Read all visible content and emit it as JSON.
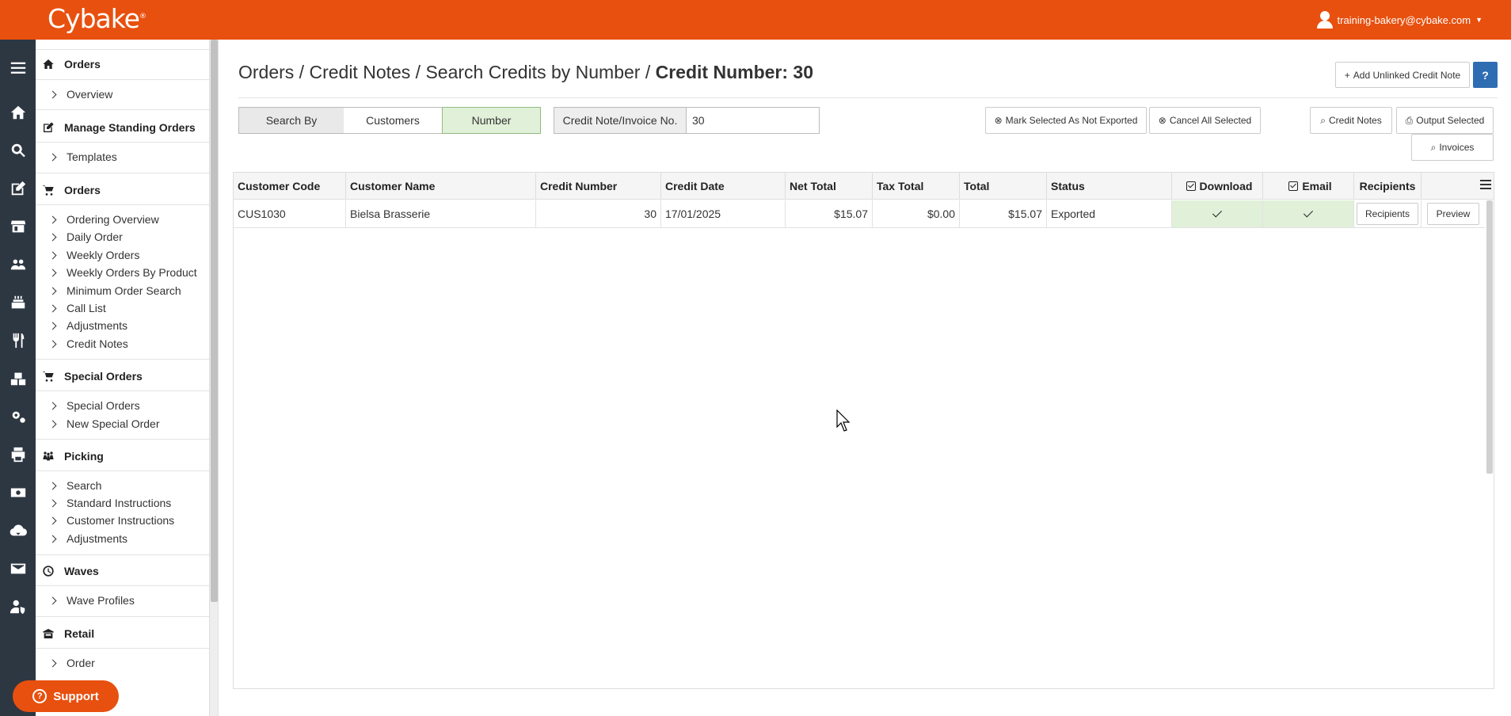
{
  "app": {
    "logo": "Cybake",
    "logo_mark": "®",
    "user_email": "training-bakery@cybake.com"
  },
  "sidebar": {
    "sections": [
      {
        "title": "Orders",
        "icon": "home-icon",
        "items": [
          "Overview"
        ]
      },
      {
        "title": "Manage Standing Orders",
        "icon": "edit-icon",
        "items": [
          "Templates"
        ]
      },
      {
        "title": "Orders",
        "icon": "cart-icon",
        "items": [
          "Ordering Overview",
          "Daily Order",
          "Weekly Orders",
          "Weekly Orders By Product",
          "Minimum Order Search",
          "Call List",
          "Adjustments",
          "Credit Notes"
        ]
      },
      {
        "title": "Special Orders",
        "icon": "cart-icon",
        "items": [
          "Special Orders",
          "New Special Order"
        ]
      },
      {
        "title": "Picking",
        "icon": "people-icon",
        "items": [
          "Search",
          "Standard Instructions",
          "Customer Instructions",
          "Adjustments"
        ]
      },
      {
        "title": "Waves",
        "icon": "clock-icon",
        "items": [
          "Wave Profiles"
        ]
      },
      {
        "title": "Retail",
        "icon": "retail-icon",
        "items": [
          "Order"
        ]
      }
    ],
    "support_label": "Support"
  },
  "page": {
    "breadcrumb": "Orders / Credit Notes / Search Credits by Number / ",
    "breadcrumb_current": "Credit Number: 30",
    "add_unlinked": "Add Unlinked Credit Note",
    "help": "?"
  },
  "search": {
    "search_by": "Search By",
    "customers": "Customers",
    "number": "Number",
    "field_label": "Credit Note/Invoice No.",
    "field_value": "30"
  },
  "actions": {
    "mark_not_exported": "Mark Selected As Not Exported",
    "cancel_all": "Cancel All Selected",
    "credit_notes": "Credit Notes",
    "output_selected": "Output Selected",
    "invoices": "Invoices"
  },
  "table": {
    "columns": [
      "Customer Code",
      "Customer Name",
      "Credit Number",
      "Credit Date",
      "Net Total",
      "Tax Total",
      "Total",
      "Status",
      "Download",
      "Email",
      "Recipients"
    ],
    "rows": [
      {
        "customer_code": "CUS1030",
        "customer_name": "Bielsa Brasserie",
        "credit_number": "30",
        "credit_date": "17/01/2025",
        "net_total": "$15.07",
        "tax_total": "$0.00",
        "total": "$15.07",
        "status": "Exported",
        "download": true,
        "email": true,
        "recipients_btn": "Recipients",
        "preview_btn": "Preview"
      }
    ]
  },
  "colors": {
    "brand": "#e8500f",
    "rail": "#2d3742",
    "selected_green": "#e1f0d9",
    "help_blue": "#2f6db3"
  }
}
